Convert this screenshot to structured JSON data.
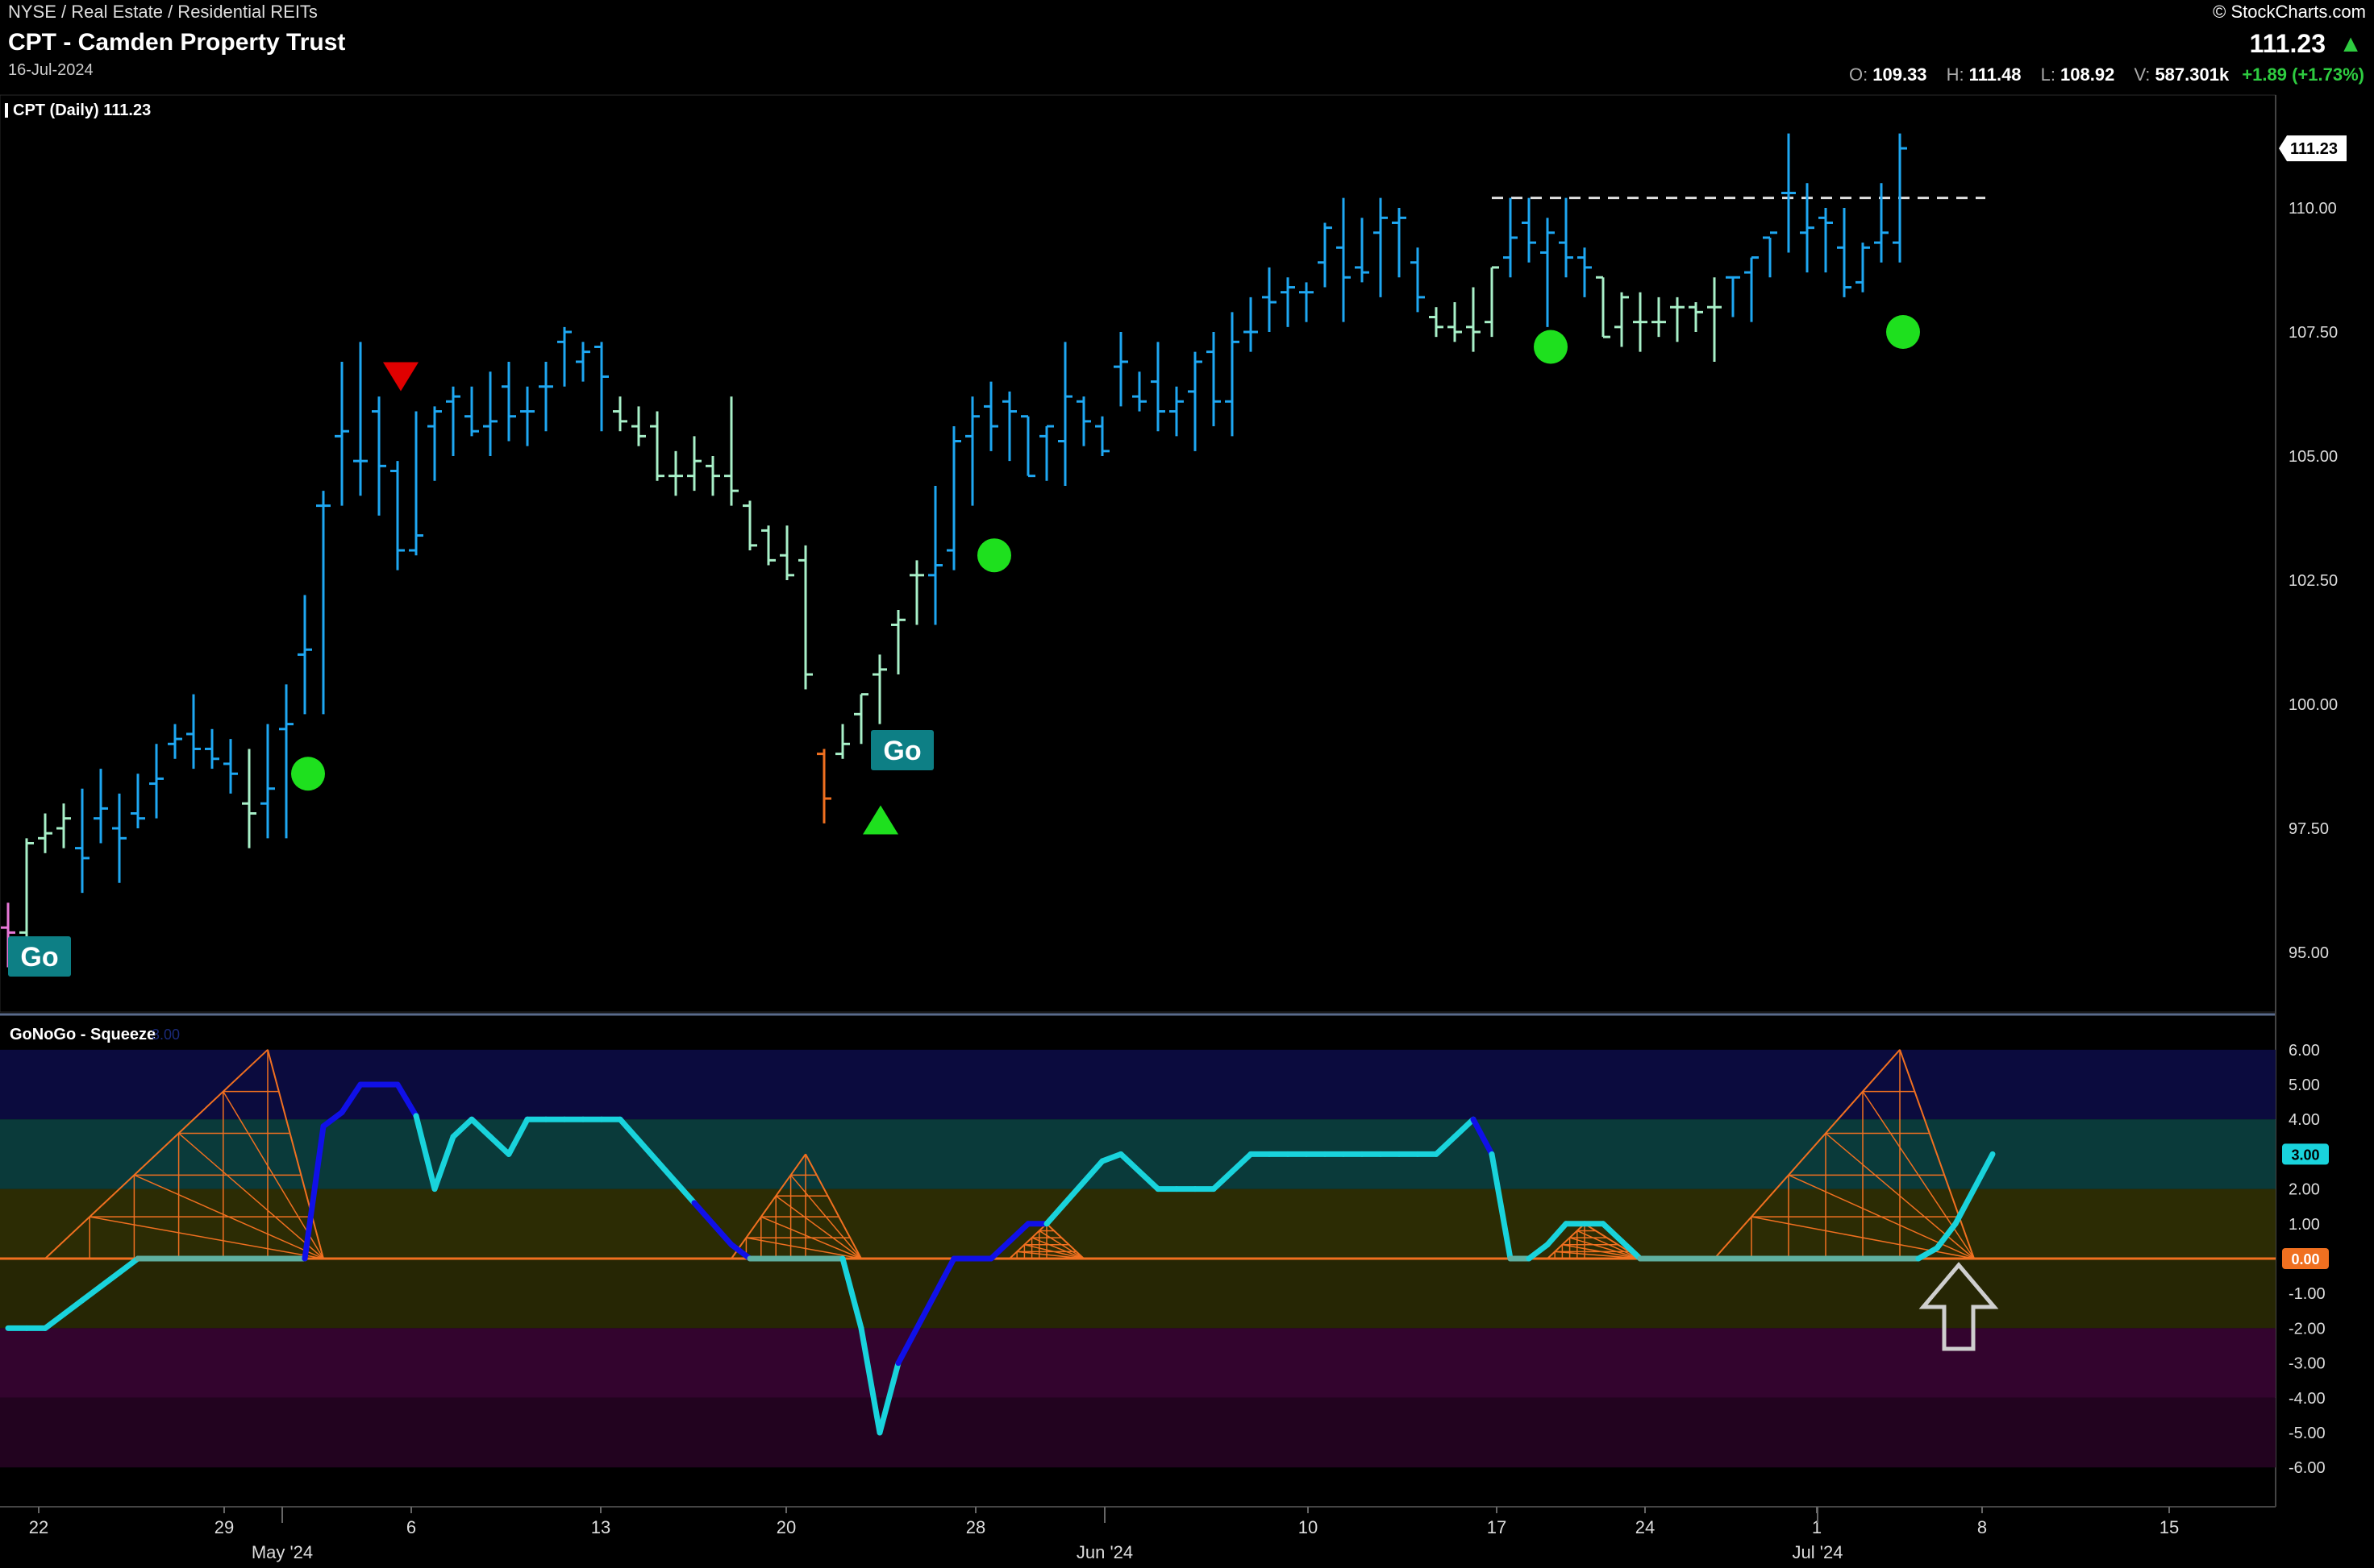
{
  "header": {
    "sector": "NYSE / Real Estate / Residential REITs",
    "name": "CPT - Camden Property Trust",
    "date": "16-Jul-2024",
    "credit": "© StockCharts.com",
    "last_price": "111.23",
    "open_label": "O:",
    "open": "109.33",
    "high_label": "H:",
    "high": "111.48",
    "low_label": "L:",
    "low": "108.92",
    "vol_label": "V:",
    "volume": "587.301k",
    "change": "+1.89 (+1.73%)"
  },
  "colors": {
    "background": "#000000",
    "go_blue": "#1ea7f2",
    "go_light": "#a8f0c8",
    "go_pink": "#e878d8",
    "go_orange": "#f07020",
    "indicator_cyan": "#19d3dc",
    "indicator_blue": "#1010e8",
    "squeeze_orange": "#f07020",
    "green_dot": "#1ee01e",
    "red_triangle": "#e00000"
  },
  "chart_data": [
    {
      "type": "ohlc",
      "label": "CPT (Daily) 111.23",
      "price_tag": "111.23",
      "y_ticks": [
        "110.00",
        "107.50",
        "105.00",
        "102.50",
        "100.00",
        "97.50",
        "95.00"
      ],
      "ylim": [
        92.5,
        111.8
      ],
      "resistance_line": 110.2,
      "x_ticks": [
        "22",
        "29",
        "6",
        "13",
        "20",
        "28",
        "10",
        "17",
        "24",
        "1",
        "8",
        "15"
      ],
      "month_labels": [
        "May '24",
        "Jun '24",
        "Jul '24"
      ],
      "bars": [
        {
          "o": 95.5,
          "h": 96.0,
          "l": 94.7,
          "c": 95.4,
          "color": "pink"
        },
        {
          "o": 95.4,
          "h": 97.3,
          "l": 94.9,
          "c": 97.2,
          "color": "light"
        },
        {
          "o": 97.3,
          "h": 97.8,
          "l": 97.0,
          "c": 97.4,
          "color": "light"
        },
        {
          "o": 97.5,
          "h": 98.0,
          "l": 97.1,
          "c": 97.7,
          "color": "light"
        },
        {
          "o": 97.1,
          "h": 98.3,
          "l": 96.2,
          "c": 96.9,
          "color": "blue"
        },
        {
          "o": 97.7,
          "h": 98.7,
          "l": 97.2,
          "c": 97.9,
          "color": "blue"
        },
        {
          "o": 97.5,
          "h": 98.2,
          "l": 96.4,
          "c": 97.3,
          "color": "blue"
        },
        {
          "o": 97.8,
          "h": 98.6,
          "l": 97.5,
          "c": 97.7,
          "color": "blue"
        },
        {
          "o": 98.4,
          "h": 99.2,
          "l": 97.7,
          "c": 98.5,
          "color": "blue"
        },
        {
          "o": 99.2,
          "h": 99.6,
          "l": 98.9,
          "c": 99.3,
          "color": "blue"
        },
        {
          "o": 99.4,
          "h": 100.2,
          "l": 98.7,
          "c": 99.1,
          "color": "blue"
        },
        {
          "o": 99.1,
          "h": 99.5,
          "l": 98.7,
          "c": 98.9,
          "color": "blue"
        },
        {
          "o": 98.8,
          "h": 99.3,
          "l": 98.2,
          "c": 98.6,
          "color": "blue"
        },
        {
          "o": 98.0,
          "h": 99.1,
          "l": 97.1,
          "c": 97.8,
          "color": "light"
        },
        {
          "o": 98.0,
          "h": 99.6,
          "l": 97.3,
          "c": 98.3,
          "color": "blue"
        },
        {
          "o": 99.5,
          "h": 100.4,
          "l": 97.3,
          "c": 99.6,
          "color": "blue"
        },
        {
          "o": 101.0,
          "h": 102.2,
          "l": 99.8,
          "c": 101.1,
          "color": "blue"
        },
        {
          "o": 104.0,
          "h": 104.3,
          "l": 99.8,
          "c": 104.0,
          "color": "blue"
        },
        {
          "o": 105.4,
          "h": 106.9,
          "l": 104.0,
          "c": 105.5,
          "color": "blue"
        },
        {
          "o": 104.9,
          "h": 107.3,
          "l": 104.2,
          "c": 104.9,
          "color": "blue"
        },
        {
          "o": 105.9,
          "h": 106.2,
          "l": 103.8,
          "c": 104.8,
          "color": "blue"
        },
        {
          "o": 104.7,
          "h": 104.9,
          "l": 102.7,
          "c": 103.1,
          "color": "blue"
        },
        {
          "o": 103.1,
          "h": 105.9,
          "l": 103.0,
          "c": 103.4,
          "color": "blue"
        },
        {
          "o": 105.6,
          "h": 106.0,
          "l": 104.5,
          "c": 105.9,
          "color": "blue"
        },
        {
          "o": 106.1,
          "h": 106.4,
          "l": 105.0,
          "c": 106.2,
          "color": "blue"
        },
        {
          "o": 105.8,
          "h": 106.4,
          "l": 105.4,
          "c": 105.5,
          "color": "blue"
        },
        {
          "o": 105.6,
          "h": 106.7,
          "l": 105.0,
          "c": 105.7,
          "color": "blue"
        },
        {
          "o": 106.4,
          "h": 106.9,
          "l": 105.3,
          "c": 105.8,
          "color": "blue"
        },
        {
          "o": 105.9,
          "h": 106.4,
          "l": 105.2,
          "c": 105.9,
          "color": "blue"
        },
        {
          "o": 106.4,
          "h": 106.9,
          "l": 105.5,
          "c": 106.4,
          "color": "blue"
        },
        {
          "o": 107.3,
          "h": 107.6,
          "l": 106.4,
          "c": 107.5,
          "color": "blue"
        },
        {
          "o": 106.9,
          "h": 107.3,
          "l": 106.5,
          "c": 107.1,
          "color": "blue"
        },
        {
          "o": 107.2,
          "h": 107.3,
          "l": 105.5,
          "c": 106.6,
          "color": "blue"
        },
        {
          "o": 105.9,
          "h": 106.2,
          "l": 105.5,
          "c": 105.7,
          "color": "light"
        },
        {
          "o": 105.6,
          "h": 106.0,
          "l": 105.2,
          "c": 105.4,
          "color": "light"
        },
        {
          "o": 105.6,
          "h": 105.9,
          "l": 104.5,
          "c": 104.6,
          "color": "light"
        },
        {
          "o": 104.6,
          "h": 105.1,
          "l": 104.2,
          "c": 104.6,
          "color": "light"
        },
        {
          "o": 104.6,
          "h": 105.4,
          "l": 104.3,
          "c": 104.9,
          "color": "light"
        },
        {
          "o": 104.8,
          "h": 105.0,
          "l": 104.2,
          "c": 104.6,
          "color": "light"
        },
        {
          "o": 104.6,
          "h": 106.2,
          "l": 104.0,
          "c": 104.3,
          "color": "light"
        },
        {
          "o": 104.0,
          "h": 104.1,
          "l": 103.1,
          "c": 103.2,
          "color": "light"
        },
        {
          "o": 103.5,
          "h": 103.6,
          "l": 102.8,
          "c": 102.9,
          "color": "light"
        },
        {
          "o": 103.0,
          "h": 103.6,
          "l": 102.5,
          "c": 102.6,
          "color": "light"
        },
        {
          "o": 102.9,
          "h": 103.2,
          "l": 100.3,
          "c": 100.6,
          "color": "light"
        },
        {
          "o": 99.0,
          "h": 99.1,
          "l": 97.6,
          "c": 98.1,
          "color": "orange"
        },
        {
          "o": 99.0,
          "h": 99.6,
          "l": 98.9,
          "c": 99.2,
          "color": "light"
        },
        {
          "o": 99.8,
          "h": 100.2,
          "l": 99.2,
          "c": 100.2,
          "color": "light"
        },
        {
          "o": 100.6,
          "h": 101.0,
          "l": 99.6,
          "c": 100.7,
          "color": "light"
        },
        {
          "o": 101.6,
          "h": 101.9,
          "l": 100.6,
          "c": 101.7,
          "color": "light"
        },
        {
          "o": 102.6,
          "h": 102.9,
          "l": 101.6,
          "c": 102.6,
          "color": "light"
        },
        {
          "o": 102.6,
          "h": 104.4,
          "l": 101.6,
          "c": 102.8,
          "color": "blue"
        },
        {
          "o": 103.1,
          "h": 105.6,
          "l": 102.7,
          "c": 105.3,
          "color": "blue"
        },
        {
          "o": 105.4,
          "h": 106.2,
          "l": 104.0,
          "c": 105.8,
          "color": "blue"
        },
        {
          "o": 106.0,
          "h": 106.5,
          "l": 105.1,
          "c": 105.6,
          "color": "blue"
        },
        {
          "o": 106.1,
          "h": 106.3,
          "l": 104.9,
          "c": 105.9,
          "color": "blue"
        },
        {
          "o": 105.8,
          "h": 105.8,
          "l": 104.6,
          "c": 104.6,
          "color": "blue"
        },
        {
          "o": 105.4,
          "h": 105.6,
          "l": 104.5,
          "c": 105.6,
          "color": "blue"
        },
        {
          "o": 105.3,
          "h": 107.3,
          "l": 104.4,
          "c": 106.2,
          "color": "blue"
        },
        {
          "o": 106.1,
          "h": 106.2,
          "l": 105.2,
          "c": 105.7,
          "color": "blue"
        },
        {
          "o": 105.6,
          "h": 105.8,
          "l": 105.0,
          "c": 105.1,
          "color": "blue"
        },
        {
          "o": 106.8,
          "h": 107.5,
          "l": 106.0,
          "c": 106.9,
          "color": "blue"
        },
        {
          "o": 106.2,
          "h": 106.7,
          "l": 105.9,
          "c": 106.1,
          "color": "blue"
        },
        {
          "o": 106.5,
          "h": 107.3,
          "l": 105.5,
          "c": 105.9,
          "color": "blue"
        },
        {
          "o": 105.9,
          "h": 106.4,
          "l": 105.4,
          "c": 106.1,
          "color": "blue"
        },
        {
          "o": 106.3,
          "h": 107.1,
          "l": 105.1,
          "c": 106.9,
          "color": "blue"
        },
        {
          "o": 107.1,
          "h": 107.5,
          "l": 105.6,
          "c": 106.1,
          "color": "blue"
        },
        {
          "o": 106.1,
          "h": 107.9,
          "l": 105.4,
          "c": 107.3,
          "color": "blue"
        },
        {
          "o": 107.5,
          "h": 108.2,
          "l": 107.1,
          "c": 107.5,
          "color": "blue"
        },
        {
          "o": 108.2,
          "h": 108.8,
          "l": 107.5,
          "c": 108.1,
          "color": "blue"
        },
        {
          "o": 108.3,
          "h": 108.6,
          "l": 107.6,
          "c": 108.4,
          "color": "blue"
        },
        {
          "o": 108.3,
          "h": 108.5,
          "l": 107.7,
          "c": 108.3,
          "color": "blue"
        },
        {
          "o": 108.9,
          "h": 109.7,
          "l": 108.4,
          "c": 109.6,
          "color": "blue"
        },
        {
          "o": 109.2,
          "h": 110.2,
          "l": 107.7,
          "c": 108.6,
          "color": "blue"
        },
        {
          "o": 108.8,
          "h": 109.8,
          "l": 108.5,
          "c": 108.7,
          "color": "blue"
        },
        {
          "o": 109.5,
          "h": 110.2,
          "l": 108.2,
          "c": 109.8,
          "color": "blue"
        },
        {
          "o": 109.7,
          "h": 110.0,
          "l": 108.6,
          "c": 109.8,
          "color": "blue"
        },
        {
          "o": 108.9,
          "h": 109.2,
          "l": 107.9,
          "c": 108.2,
          "color": "blue"
        },
        {
          "o": 107.8,
          "h": 108.0,
          "l": 107.4,
          "c": 107.6,
          "color": "light"
        },
        {
          "o": 107.6,
          "h": 108.1,
          "l": 107.3,
          "c": 107.5,
          "color": "light"
        },
        {
          "o": 107.6,
          "h": 108.4,
          "l": 107.1,
          "c": 107.5,
          "color": "light"
        },
        {
          "o": 107.7,
          "h": 108.8,
          "l": 107.4,
          "c": 108.8,
          "color": "light"
        },
        {
          "o": 109.0,
          "h": 110.2,
          "l": 108.6,
          "c": 109.4,
          "color": "blue"
        },
        {
          "o": 109.7,
          "h": 110.2,
          "l": 108.9,
          "c": 109.3,
          "color": "blue"
        },
        {
          "o": 109.1,
          "h": 109.8,
          "l": 107.6,
          "c": 109.5,
          "color": "blue"
        },
        {
          "o": 109.3,
          "h": 110.2,
          "l": 108.6,
          "c": 109.0,
          "color": "blue"
        },
        {
          "o": 109.0,
          "h": 109.2,
          "l": 108.2,
          "c": 108.8,
          "color": "blue"
        },
        {
          "o": 108.6,
          "h": 108.6,
          "l": 107.4,
          "c": 107.4,
          "color": "light"
        },
        {
          "o": 107.6,
          "h": 108.3,
          "l": 107.2,
          "c": 108.2,
          "color": "light"
        },
        {
          "o": 107.7,
          "h": 108.3,
          "l": 107.1,
          "c": 107.7,
          "color": "light"
        },
        {
          "o": 107.7,
          "h": 108.2,
          "l": 107.4,
          "c": 107.7,
          "color": "light"
        },
        {
          "o": 108.0,
          "h": 108.2,
          "l": 107.3,
          "c": 108.0,
          "color": "light"
        },
        {
          "o": 108.0,
          "h": 108.1,
          "l": 107.5,
          "c": 107.9,
          "color": "light"
        },
        {
          "o": 108.0,
          "h": 108.6,
          "l": 106.9,
          "c": 108.0,
          "color": "light"
        },
        {
          "o": 108.6,
          "h": 108.6,
          "l": 107.8,
          "c": 108.6,
          "color": "blue"
        },
        {
          "o": 108.7,
          "h": 109.0,
          "l": 107.7,
          "c": 109.0,
          "color": "blue"
        },
        {
          "o": 109.4,
          "h": 109.4,
          "l": 108.6,
          "c": 109.5,
          "color": "blue"
        },
        {
          "o": 110.3,
          "h": 111.5,
          "l": 109.1,
          "c": 110.3,
          "color": "blue"
        },
        {
          "o": 109.5,
          "h": 110.5,
          "l": 108.7,
          "c": 109.6,
          "color": "blue"
        },
        {
          "o": 109.8,
          "h": 110.0,
          "l": 108.7,
          "c": 109.7,
          "color": "blue"
        },
        {
          "o": 109.2,
          "h": 110.0,
          "l": 108.2,
          "c": 108.4,
          "color": "blue"
        },
        {
          "o": 108.5,
          "h": 109.3,
          "l": 108.3,
          "c": 109.2,
          "color": "blue"
        },
        {
          "o": 109.3,
          "h": 110.5,
          "l": 108.9,
          "c": 109.5,
          "color": "blue"
        },
        {
          "o": 109.3,
          "h": 111.5,
          "l": 108.9,
          "c": 111.2,
          "color": "blue"
        }
      ],
      "go_labels": [
        {
          "bar": 0,
          "text": "Go"
        },
        {
          "bar": 46,
          "text": "Go"
        }
      ],
      "green_dots": [
        {
          "bar": 16,
          "value": 98.6
        },
        {
          "bar": 53,
          "value": 103.0
        },
        {
          "bar": 83,
          "value": 107.2
        },
        {
          "bar": 102,
          "value": 107.5
        }
      ],
      "red_triangles": [
        {
          "bar": 21,
          "value": 106.6
        }
      ],
      "green_triangles": [
        {
          "bar": 46,
          "value": 97.8
        }
      ]
    },
    {
      "type": "line",
      "label": "GoNoGo - Squeeze",
      "label_value": "3.00",
      "y_ticks": [
        "6.00",
        "5.00",
        "4.00",
        "3.00",
        "2.00",
        "1.00",
        "0.00",
        "-1.00",
        "-2.00",
        "-3.00",
        "-4.00",
        "-5.00",
        "-6.00"
      ],
      "ylim": [
        -6.0,
        6.0
      ],
      "current_value": "3.00",
      "zero_value": "0.00",
      "series": [
        {
          "values": [
            -2,
            -2,
            -2,
            -1.6,
            -1.2,
            -0.8,
            -0.4,
            0,
            0,
            0,
            0,
            0,
            0,
            0,
            0,
            0,
            0,
            3.8,
            4.2,
            5,
            5,
            5,
            4.1,
            2,
            3.5,
            4,
            3.5,
            3,
            4,
            4,
            4,
            4,
            4,
            4,
            3.4,
            2.8,
            2.2,
            1.6,
            1,
            0.4,
            0,
            0,
            0,
            0,
            0,
            0,
            -2,
            -5,
            -3,
            -2,
            -1,
            0,
            0,
            0,
            0.5,
            1,
            1,
            1.6,
            2.2,
            2.8,
            3,
            2.5,
            2,
            2,
            2,
            2,
            2.5,
            3,
            3,
            3,
            3,
            3,
            3,
            3,
            3,
            3,
            3,
            3,
            3.5,
            4,
            3,
            0,
            0,
            0.4,
            1,
            1,
            1,
            0.5,
            0,
            0,
            0,
            0,
            0,
            0,
            0,
            0,
            0,
            0,
            0,
            0,
            0,
            0,
            0,
            0,
            0.3,
            1,
            2,
            3
          ]
        }
      ],
      "blue_segments": [
        [
          16,
          22
        ],
        [
          37,
          40
        ],
        [
          48,
          56
        ],
        [
          79,
          80
        ]
      ],
      "squeeze_grids": [
        {
          "start": 2,
          "end": 17,
          "peak_bar": 14,
          "peak_value": 6
        },
        {
          "start": 39,
          "end": 46,
          "peak_bar": 43,
          "peak_value": 3
        },
        {
          "start": 54,
          "end": 58,
          "peak_bar": 56,
          "peak_value": 1
        },
        {
          "start": 83,
          "end": 88,
          "peak_bar": 85,
          "peak_value": 1
        },
        {
          "start": 92,
          "end": 106,
          "peak_bar": 102,
          "peak_value": 6
        }
      ],
      "up_arrow_bar": 105
    }
  ]
}
